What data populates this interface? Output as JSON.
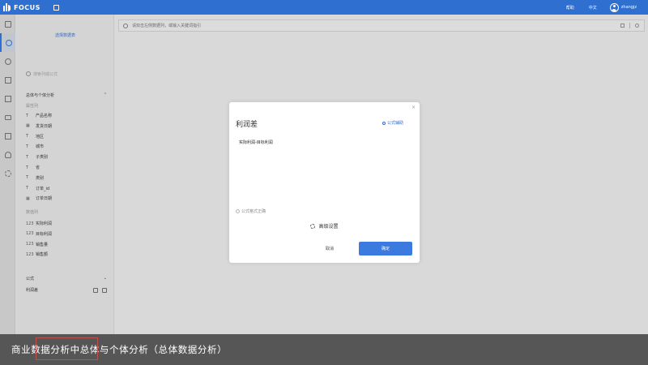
{
  "topbar": {
    "logo_text": "FOCUS",
    "help": "帮助",
    "language": "中文",
    "username": "zhangjz"
  },
  "panel": {
    "select_table": "选择数据表",
    "search_placeholder": "搜索列或公式",
    "section_title": "总体与个体分析",
    "dimension_label": "属性列",
    "dimensions": [
      {
        "type": "T",
        "name": "产品名称"
      },
      {
        "type": "date",
        "name": "发货日期"
      },
      {
        "type": "T",
        "name": "地区"
      },
      {
        "type": "T",
        "name": "城市"
      },
      {
        "type": "T",
        "name": "子类别"
      },
      {
        "type": "T",
        "name": "省"
      },
      {
        "type": "T",
        "name": "类别"
      },
      {
        "type": "T",
        "name": "订单_id"
      },
      {
        "type": "date",
        "name": "订单日期"
      }
    ],
    "measure_label": "数值列",
    "measures": [
      {
        "type": "123",
        "name": "实际利润"
      },
      {
        "type": "123",
        "name": "目标利润"
      },
      {
        "type": "123",
        "name": "销售量"
      },
      {
        "type": "123",
        "name": "销售额"
      }
    ],
    "formula_label": "公式",
    "formula_item": "利润差"
  },
  "searchbar": {
    "placeholder": "请双击左侧数据列，或输入关键词指引"
  },
  "modal": {
    "close": "×",
    "title": "利润差",
    "helper": "公式辅助",
    "expression": "实际利润-目标利润",
    "status": "公式格式正确",
    "advanced": "高级设置",
    "cancel": "取消",
    "confirm": "确定"
  },
  "caption": {
    "text": "商业数据分析中总体与个体分析（总体数据分析）"
  },
  "colors": {
    "brand_blue": "#2f6fd0",
    "confirm_blue": "#3b7be0",
    "highlight_red": "#c0504d"
  }
}
